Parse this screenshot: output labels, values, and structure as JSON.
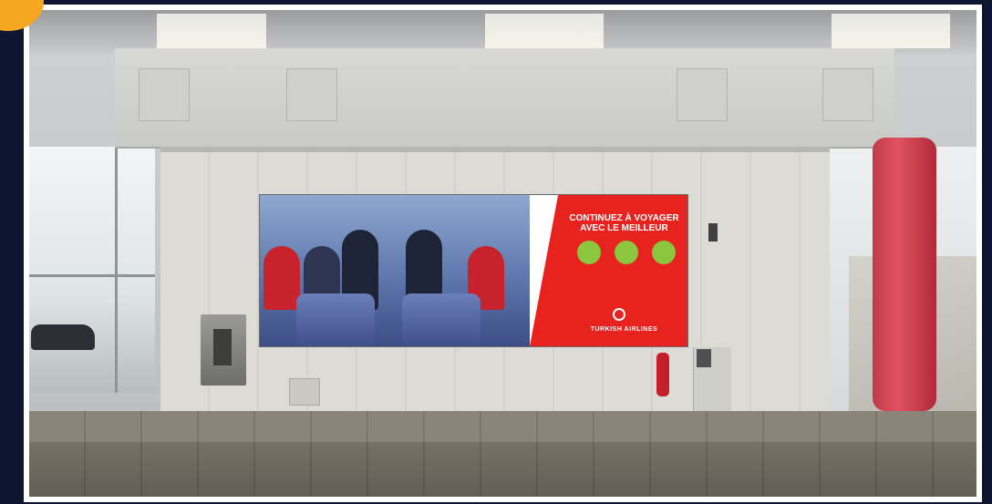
{
  "ad": {
    "kicker": "",
    "headline": "CONTINUEZ À VOYAGER AVEC LE MEILLEUR",
    "badges": [
      "",
      "",
      ""
    ],
    "body": "",
    "brand": "TURKISH AIRLINES"
  },
  "colors": {
    "frame": "#ffffff",
    "background": "#0d1530",
    "ad_red": "#e8231f",
    "badge_green": "#8cc63f",
    "pillar_red": "#d0414f"
  }
}
